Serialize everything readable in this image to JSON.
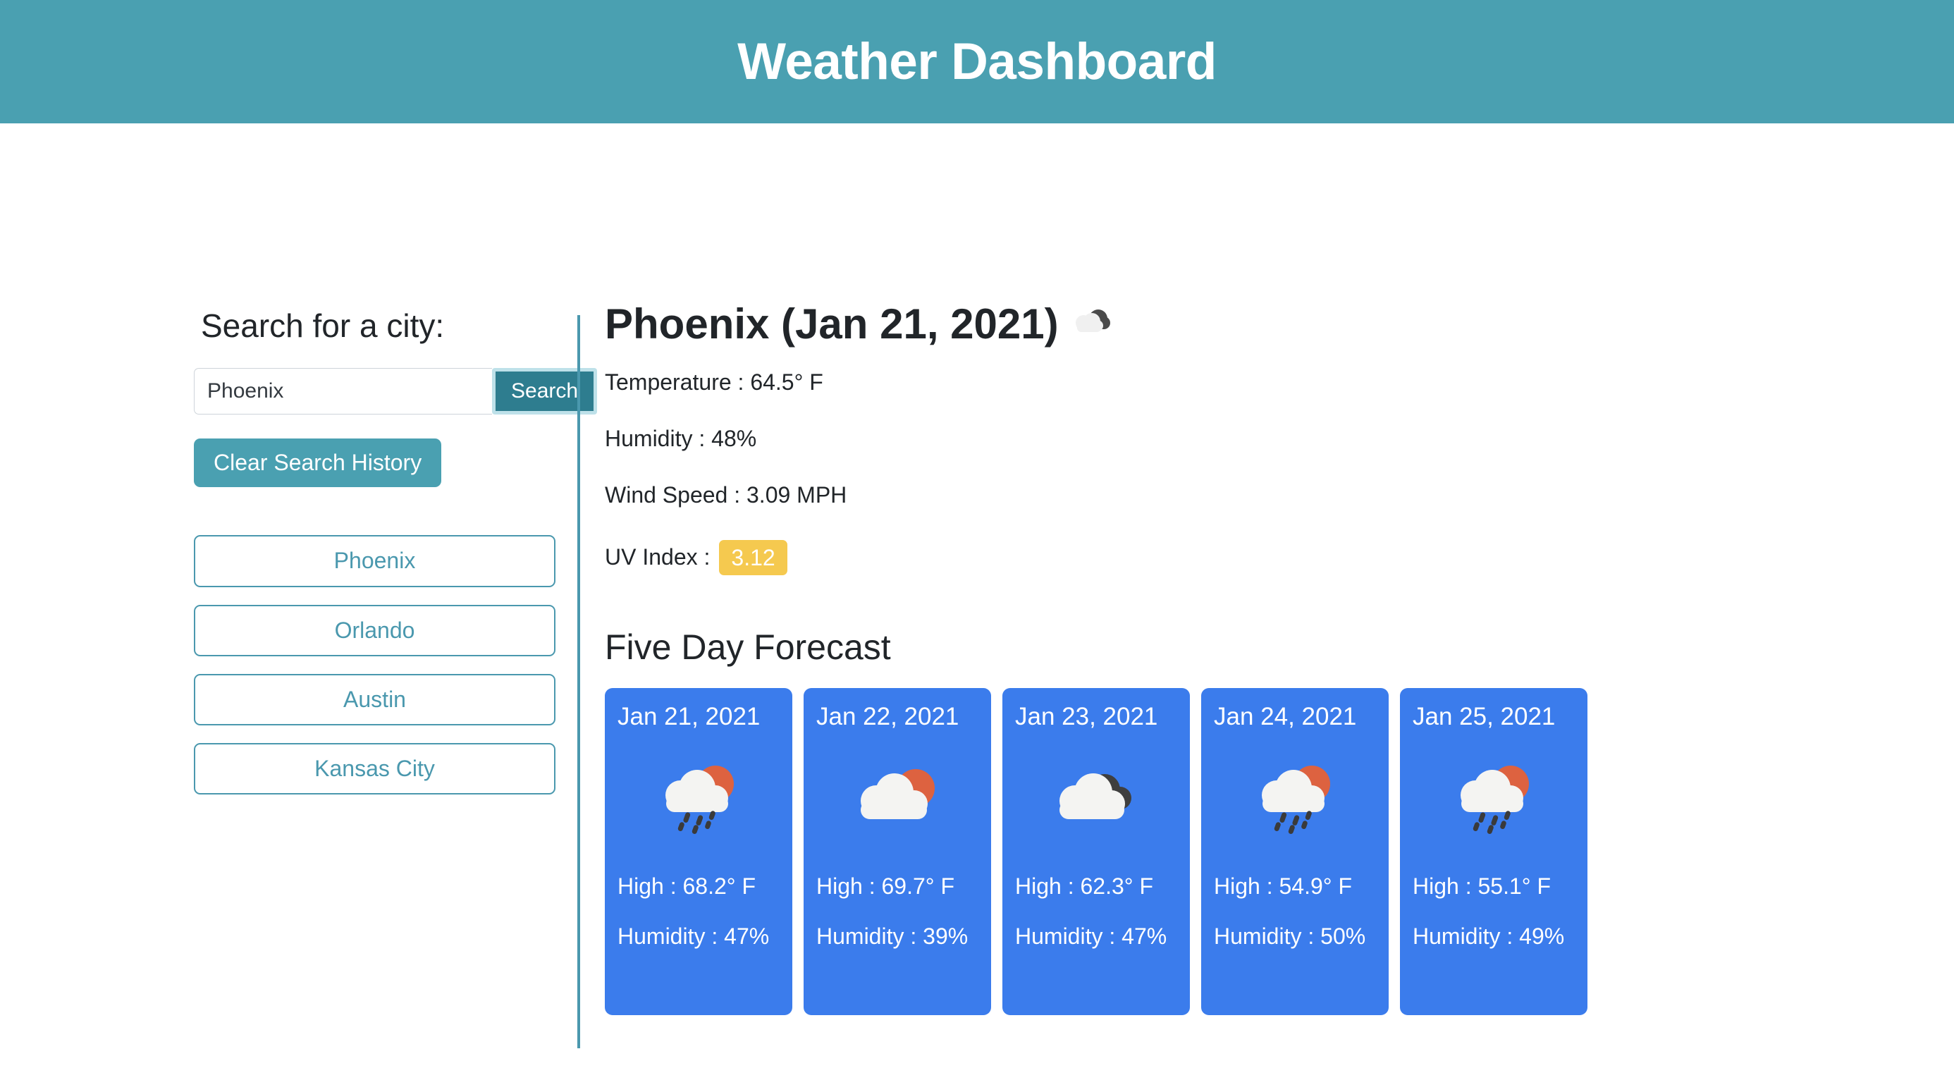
{
  "header": {
    "title": "Weather Dashboard",
    "background_color": "#4AA0B1"
  },
  "sidebar": {
    "heading": "Search for a city:",
    "search": {
      "value": "Phoenix",
      "placeholder": "",
      "button_label": "Search",
      "button_color": "#2E7D8F",
      "focus_ring_color": "#BEE1E9"
    },
    "clear_button": {
      "label": "Clear Search History",
      "color": "#4AA0B1"
    },
    "history": [
      {
        "label": "Phoenix"
      },
      {
        "label": "Orlando"
      },
      {
        "label": "Austin"
      },
      {
        "label": "Kansas City"
      }
    ],
    "history_color": "#4A98AE"
  },
  "divider_color": "#4A98AE",
  "current": {
    "title": "Phoenix (Jan 21, 2021)",
    "icon": "broken-clouds-icon",
    "temperature_label": "Temperature : 64.5° F",
    "humidity_label": "Humidity : 48%",
    "wind_label": "Wind Speed : 3.09 MPH",
    "uv_label": "UV Index :",
    "uv_value": "3.12",
    "uv_badge_color": "#F5C94F"
  },
  "forecast": {
    "heading": "Five Day Forecast",
    "card_color": "#3B7CEC",
    "days": [
      {
        "date": "Jan 21, 2021",
        "icon": "sun-cloud-rain-icon",
        "high": "High : 68.2° F",
        "humidity": "Humidity : 47%"
      },
      {
        "date": "Jan 22, 2021",
        "icon": "sun-cloud-icon",
        "high": "High : 69.7° F",
        "humidity": "Humidity : 39%"
      },
      {
        "date": "Jan 23, 2021",
        "icon": "broken-clouds-icon",
        "high": "High : 62.3° F",
        "humidity": "Humidity : 47%"
      },
      {
        "date": "Jan 24, 2021",
        "icon": "sun-cloud-rain-icon",
        "high": "High : 54.9° F",
        "humidity": "Humidity : 50%"
      },
      {
        "date": "Jan 25, 2021",
        "icon": "sun-cloud-rain-icon",
        "high": "High : 55.1° F",
        "humidity": "Humidity : 49%"
      }
    ]
  }
}
